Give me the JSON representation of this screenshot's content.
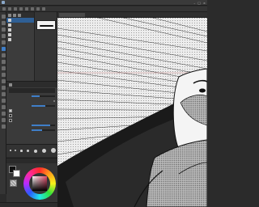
{
  "colors": {
    "accent": "#3f7ec8",
    "panel": "#3a3a3a",
    "canvas": "#e8e8e8",
    "ink": "#111111",
    "screentone": "#9a9a9a",
    "guide_line": "#5aa0d8"
  },
  "tool_property": {
    "selected_value": "0"
  },
  "color": {
    "main": "#111111",
    "sub": "#ffffff",
    "wheel_hue": "#e04a6a"
  },
  "icons": {
    "tools": [
      "move-icon",
      "zoom-icon",
      "select-icon",
      "lasso-icon",
      "eyedropper-icon",
      "pen-icon",
      "pencil-icon",
      "brush-icon",
      "airbrush-icon",
      "decoration-icon",
      "eraser-icon",
      "fill-icon",
      "gradient-icon",
      "figure-icon",
      "ruler-icon",
      "text-icon",
      "balloon-icon",
      "line-correction-icon"
    ]
  }
}
